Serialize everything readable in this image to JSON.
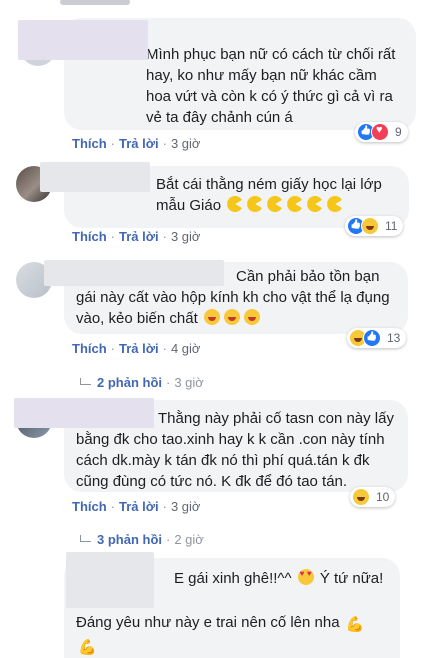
{
  "labels": {
    "like": "Thích",
    "reply": "Trả lời"
  },
  "comments": [
    {
      "text": "Mình phục bạn nữ có cách từ chối rất hay, ko như mấy bạn nữ khác cầm hoa vứt và còn k có ý thức gì cả vì ra vẻ ta đây chảnh cún á",
      "time": "3 giờ",
      "reaction_count": "9",
      "reactions": [
        "like-icon",
        "love-icon"
      ]
    },
    {
      "text": "Bắt cái thằng ném giấy học lại lớp mẫu Giáo",
      "time": "3 giờ",
      "reaction_count": "11",
      "reactions": [
        "like-icon",
        "haha-icon"
      ]
    },
    {
      "text_start": "Cần phải bảo tồn bạn",
      "text": "gái này cất vào hộp kính kh cho vật thể lạ đụng vào, kẻo biến chất",
      "time": "4 giờ",
      "reaction_count": "13",
      "reactions": [
        "haha-icon",
        "like-icon"
      ],
      "replies": "2 phản hồi",
      "replies_time": "3 giờ"
    },
    {
      "text": "Thằng này phải cố tasn con này lấy bằng đk cho tao.xinh hay k k cần .con này tính cách dk.mày k tán đk nó thì phí quá.tán k đk cũng đùng có tức nó. K đk để đó tao tán.",
      "time": "3 giờ",
      "reaction_count": "10",
      "reactions": [
        "haha-icon"
      ],
      "replies": "3 phản hồi",
      "replies_time": "2 giờ"
    },
    {
      "text": "E gái xinh ghê!!^^",
      "text2": "Ý tứ nữa!",
      "text3": "Đáng yêu như này e trai nên cố lên nha"
    }
  ]
}
